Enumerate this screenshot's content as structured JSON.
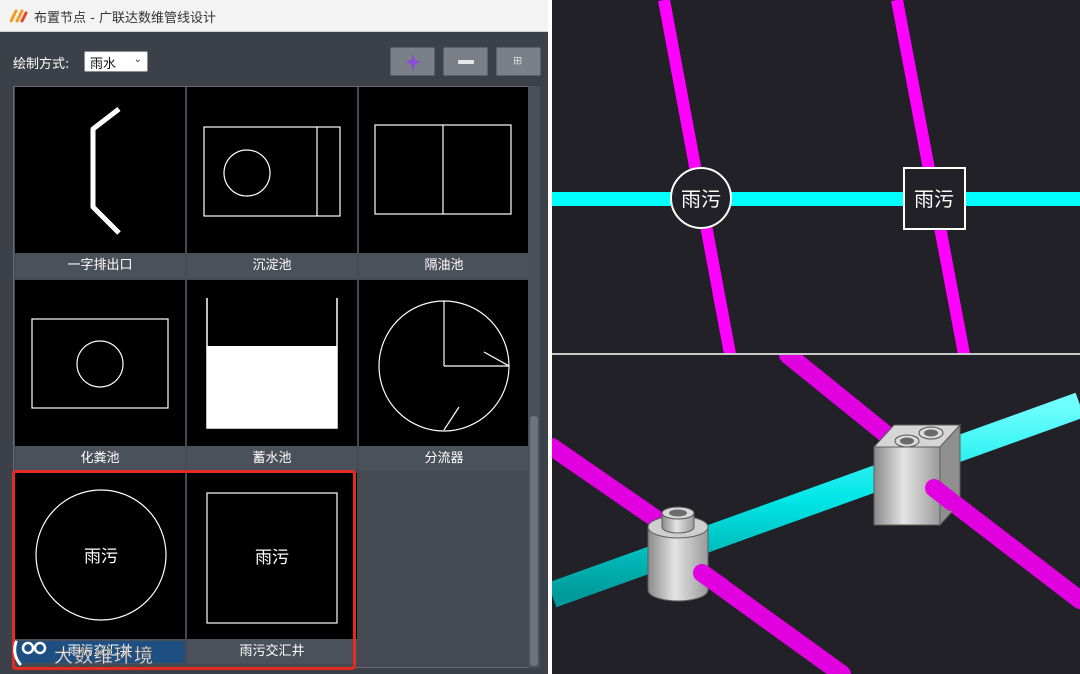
{
  "window": {
    "title": "布置节点 - 广联达数维管线设计"
  },
  "toolbar": {
    "mode_label": "绘制方式:",
    "mode_value": "雨水",
    "buttons": [
      {
        "name": "add",
        "icon": "add-node-icon"
      },
      {
        "name": "remove",
        "icon": "minus-icon"
      },
      {
        "name": "grid",
        "icon": "grid-view-icon"
      }
    ]
  },
  "nodes": [
    {
      "label": "一字排出口",
      "icon": "outlet-symbol"
    },
    {
      "label": "沉淀池",
      "icon": "sedimentation-tank-symbol"
    },
    {
      "label": "隔油池",
      "icon": "grease-trap-symbol"
    },
    {
      "label": "化粪池",
      "icon": "septic-tank-symbol"
    },
    {
      "label": "蓄水池",
      "icon": "reservoir-symbol"
    },
    {
      "label": "分流器",
      "icon": "splitter-symbol"
    },
    {
      "label": "雨污交汇井",
      "icon": "round-junction-well-symbol",
      "symbol_text": "雨污",
      "selected": true
    },
    {
      "label": "雨污交汇井",
      "icon": "square-junction-well-symbol",
      "symbol_text": "雨污"
    }
  ],
  "watermark": {
    "text": "大数维环境"
  },
  "plan_view": {
    "labels": [
      "雨污",
      "雨污"
    ]
  },
  "colors": {
    "rain_pipe": "#00ffff",
    "sewage_pipe": "#ff00ff",
    "highlight": "#e32b22",
    "selection": "#1e4f82"
  }
}
